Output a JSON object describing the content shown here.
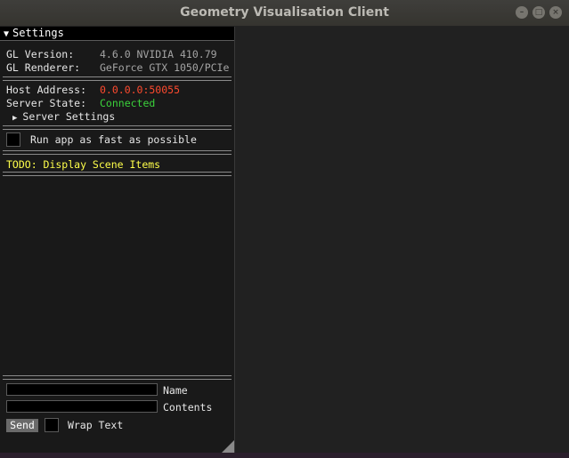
{
  "window": {
    "title": "Geometry Visualisation Client",
    "buttons": {
      "minimize": "–",
      "maximize": "□",
      "close": "×"
    }
  },
  "settings": {
    "header": "Settings",
    "gl_version_label": "GL Version:",
    "gl_version_value": "4.6.0 NVIDIA 410.79",
    "gl_renderer_label": "GL Renderer:",
    "gl_renderer_value": "GeForce GTX 1050/PCIe",
    "host_address_label": "Host Address:",
    "host_address_value": "0.0.0.0:50055",
    "server_state_label": "Server State:",
    "server_state_value": "Connected",
    "server_settings_label": "Server Settings",
    "run_fast_label": "Run app as fast as possible",
    "todo_text": "TODO: Display Scene Items"
  },
  "message": {
    "name_field": {
      "value": "",
      "label": "Name"
    },
    "contents_field": {
      "value": "",
      "label": "Contents"
    },
    "send_label": "Send",
    "wrap_text_label": "Wrap Text"
  },
  "colors": {
    "host_address": "#ff4a2e",
    "server_state": "#3bd23b",
    "todo": "#ffff4a"
  }
}
